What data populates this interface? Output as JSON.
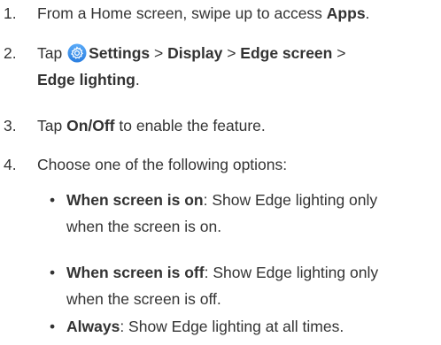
{
  "steps": [
    {
      "number": "1.",
      "text_a": "From a Home screen, swipe up to access ",
      "bold_a": "Apps",
      "text_b": "."
    },
    {
      "number": "2.",
      "text_a": "Tap ",
      "icon": "settings-gear-icon",
      "bold_a": "Settings",
      "sep1": " > ",
      "bold_b": "Display",
      "sep2": " > ",
      "bold_c": "Edge screen",
      "sep3": " >",
      "bold_d": "Edge lighting",
      "text_end": "."
    },
    {
      "number": "3.",
      "text_a": "Tap ",
      "bold_a": "On/Off",
      "text_b": " to enable the feature."
    },
    {
      "number": "4.",
      "text_a": "Choose one of the following options:"
    }
  ],
  "options": [
    {
      "bullet": "•",
      "bold": "When screen is on",
      "text": ": Show Edge lighting only",
      "text2": "when the screen is on."
    },
    {
      "bullet": "•",
      "bold": "When screen is off",
      "text": ": Show Edge lighting only",
      "text2": "when the screen is off."
    },
    {
      "bullet": "•",
      "bold": "Always",
      "text": ": Show Edge lighting at all times."
    }
  ],
  "colors": {
    "text": "#333333",
    "icon_bg_start": "#4fa3f7",
    "icon_bg_end": "#2b7fe0",
    "icon_fg": "#ffffff"
  }
}
